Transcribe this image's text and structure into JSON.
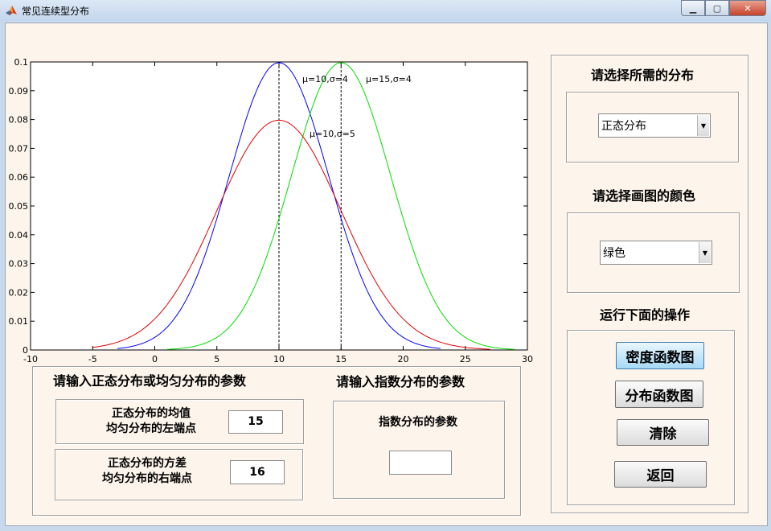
{
  "window": {
    "title": "常见连续型分布"
  },
  "chart_data": {
    "type": "line",
    "xlim": [
      -10,
      30
    ],
    "ylim": [
      0,
      0.1
    ],
    "x_ticks": [
      "-10",
      "-5",
      "0",
      "5",
      "10",
      "15",
      "20",
      "25",
      "30"
    ],
    "y_ticks": [
      "0",
      "0.01",
      "0.02",
      "0.03",
      "0.04",
      "0.05",
      "0.06",
      "0.07",
      "0.08",
      "0.09",
      "0.1"
    ],
    "grid": false,
    "series": [
      {
        "name": "μ=10,σ=4",
        "mu": 10,
        "sigma": 4,
        "x_range": [
          -3,
          23
        ],
        "color": "#0000ff"
      },
      {
        "name": "μ=15,σ=4",
        "mu": 15,
        "sigma": 4,
        "x_range": [
          1,
          29
        ],
        "color": "#00dd00"
      },
      {
        "name": "μ=10,σ=5",
        "mu": 10,
        "sigma": 5,
        "x_range": [
          -5,
          27
        ],
        "color": "#dd0000"
      }
    ],
    "vlines": [
      10,
      15
    ]
  },
  "params_panel": {
    "title": "请输入正态分布或均匀分布的参数",
    "mean_label_line1": "正态分布的均值",
    "mean_label_line2": "均匀分布的左端点",
    "mean_value": "15",
    "var_label_line1": "正态分布的方差",
    "var_label_line2": "均匀分布的右端点",
    "var_value": "16"
  },
  "exp_panel": {
    "title": "请输入指数分布的参数",
    "param_label": "指数分布的参数",
    "param_value": ""
  },
  "right_panel": {
    "dist_title": "请选择所需的分布",
    "dist_selected": "正态分布",
    "color_title": "请选择画图的颜色",
    "color_selected": "绿色",
    "ops_title": "运行下面的操作",
    "btn_density": "密度函数图",
    "btn_cdf": "分布函数图",
    "btn_clear": "清除",
    "btn_back": "返回"
  }
}
